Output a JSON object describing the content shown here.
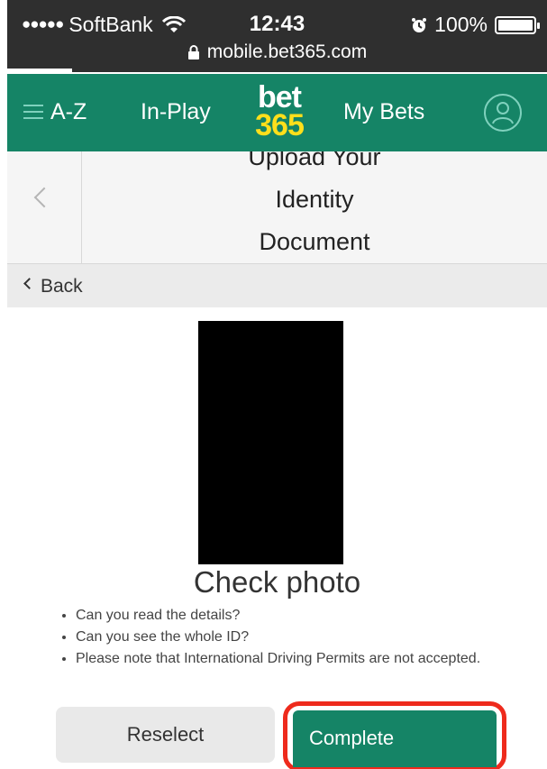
{
  "status_bar": {
    "signal_dots": "●●●●●",
    "carrier": "SoftBank",
    "time": "12:43",
    "battery": "100%",
    "url": "mobile.bet365.com"
  },
  "nav": {
    "az_label": "A-Z",
    "inplay_label": "In-Play",
    "logo_top": "bet",
    "logo_bottom": "365",
    "mybets_label": "My Bets"
  },
  "header": {
    "title_line1": "Upload Your",
    "title_line2": "Identity",
    "title_line3": "Document"
  },
  "back": {
    "label": "Back"
  },
  "content": {
    "check_title": "Check photo",
    "instructions": [
      "Can you read the details?",
      "Can you see the whole ID?",
      "Please note that International Driving Permits are not accepted."
    ]
  },
  "buttons": {
    "reselect": "Reselect",
    "complete": "Complete"
  },
  "colors": {
    "brand_green": "#158466",
    "logo_yellow": "#ffdf1b",
    "highlight_red": "#ee2a1c"
  }
}
